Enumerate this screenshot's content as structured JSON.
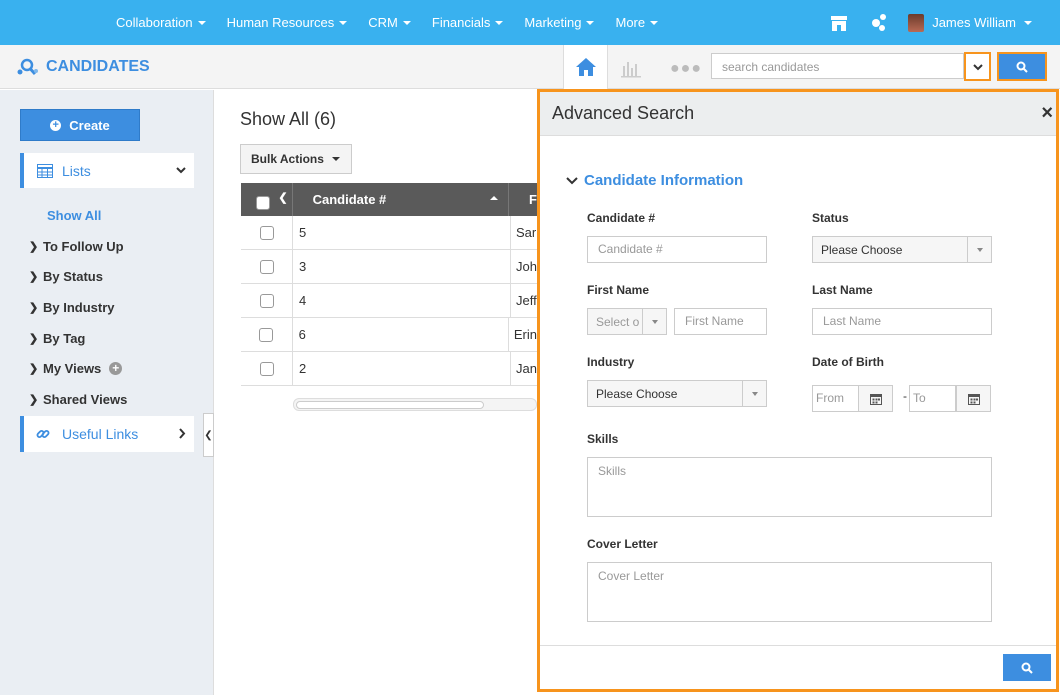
{
  "topnav": {
    "items": [
      {
        "label": "Collaboration"
      },
      {
        "label": "Human Resources"
      },
      {
        "label": "CRM"
      },
      {
        "label": "Financials"
      },
      {
        "label": "Marketing"
      },
      {
        "label": "More"
      }
    ],
    "user_name": "James William"
  },
  "header": {
    "module_title": "CANDIDATES",
    "search_placeholder": "search candidates"
  },
  "sidebar": {
    "create_label": "Create",
    "lists_label": "Lists",
    "items": [
      {
        "label": "Show All"
      },
      {
        "label": "To Follow Up"
      },
      {
        "label": "By Status"
      },
      {
        "label": "By Industry"
      },
      {
        "label": "By Tag"
      },
      {
        "label": "My Views"
      },
      {
        "label": "Shared Views"
      }
    ],
    "useful_links_label": "Useful Links"
  },
  "main": {
    "title": "Show All (6)",
    "bulk_actions_label": "Bulk Actions",
    "table": {
      "column_header": "Candidate #",
      "next_column_header_fragment": "F",
      "rows": [
        {
          "num": "5",
          "first": "Sar"
        },
        {
          "num": "3",
          "first": "Joh"
        },
        {
          "num": "4",
          "first": "Jeff"
        },
        {
          "num": "6",
          "first": "Erin"
        },
        {
          "num": "2",
          "first": "Jan"
        }
      ]
    }
  },
  "advanced_search": {
    "title": "Advanced Search",
    "close": "×",
    "section_title": "Candidate Information",
    "candidate_num_label": "Candidate #",
    "candidate_num_placeholder": "Candidate #",
    "status_label": "Status",
    "status_value": "Please Choose",
    "first_name_label": "First Name",
    "salutation_value": "Select o",
    "first_name_placeholder": "First Name",
    "last_name_label": "Last Name",
    "last_name_placeholder": "Last Name",
    "industry_label": "Industry",
    "industry_value": "Please Choose",
    "dob_label": "Date of Birth",
    "dob_from_placeholder": "From",
    "dob_to_placeholder": "To",
    "dob_separator": "-",
    "skills_label": "Skills",
    "skills_placeholder": "Skills",
    "cover_letter_label": "Cover Letter",
    "cover_letter_placeholder": "Cover Letter"
  },
  "colors": {
    "topbar": "#39b1ef",
    "accent": "#3d8ee0",
    "highlight": "#f7941d"
  }
}
